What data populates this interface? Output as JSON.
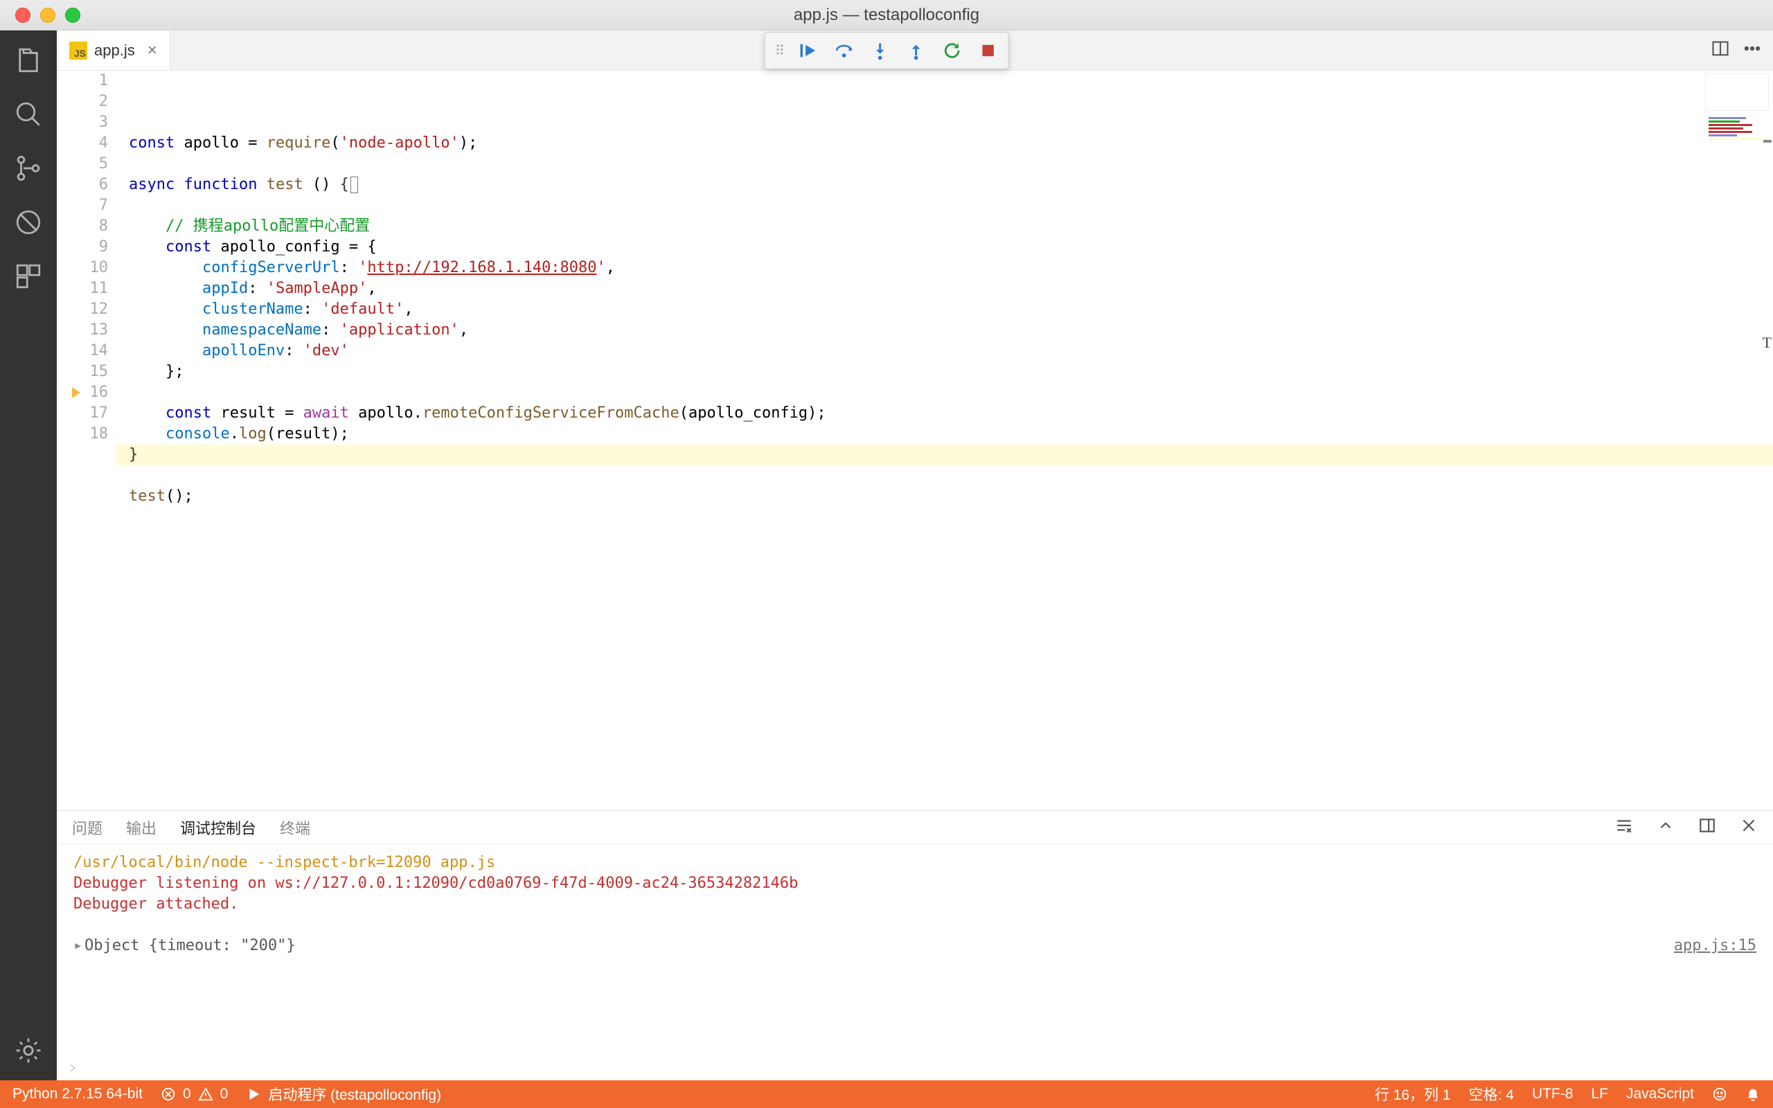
{
  "window": {
    "title": "app.js — testapolloconfig"
  },
  "tab": {
    "filename": "app.js"
  },
  "debug_toolbar": {
    "continue": "Continue",
    "step_over": "Step Over",
    "step_into": "Step Into",
    "step_out": "Step Out",
    "restart": "Restart",
    "stop": "Stop"
  },
  "editor": {
    "highlighted_line": 16,
    "lines": [
      {
        "n": 1,
        "t": "const apollo = require('node-apollo');"
      },
      {
        "n": 2,
        "t": ""
      },
      {
        "n": 3,
        "t": "async function test () {"
      },
      {
        "n": 4,
        "t": ""
      },
      {
        "n": 5,
        "t": "    // 携程apollo配置中心配置"
      },
      {
        "n": 6,
        "t": "    const apollo_config = {"
      },
      {
        "n": 7,
        "t": "        configServerUrl: 'http://192.168.1.140:8080',"
      },
      {
        "n": 8,
        "t": "        appId: 'SampleApp',"
      },
      {
        "n": 9,
        "t": "        clusterName: 'default',"
      },
      {
        "n": 10,
        "t": "        namespaceName: 'application',"
      },
      {
        "n": 11,
        "t": "        apolloEnv: 'dev'"
      },
      {
        "n": 12,
        "t": "    };"
      },
      {
        "n": 13,
        "t": ""
      },
      {
        "n": 14,
        "t": "    const result = await apollo.remoteConfigServiceFromCache(apollo_config);"
      },
      {
        "n": 15,
        "t": "    console.log(result);"
      },
      {
        "n": 16,
        "t": "}"
      },
      {
        "n": 17,
        "t": ""
      },
      {
        "n": 18,
        "t": "test();"
      }
    ]
  },
  "panel": {
    "tabs": {
      "problems": "问题",
      "output": "输出",
      "debug_console": "调试控制台",
      "terminal": "终端"
    },
    "active_tab": "debug_console",
    "lines": [
      {
        "cls": "pc-orange",
        "t": "/usr/local/bin/node --inspect-brk=12090 app.js"
      },
      {
        "cls": "pc-red",
        "t": "Debugger listening on ws://127.0.0.1:12090/cd0a0769-f47d-4009-ac24-36534282146b"
      },
      {
        "cls": "pc-red",
        "t": "Debugger attached."
      }
    ],
    "object_line": "Object {timeout: \"200\"}",
    "object_source": "app.js:15"
  },
  "statusbar": {
    "python": "Python 2.7.15 64-bit",
    "errors": "0",
    "warnings": "0",
    "launch": "启动程序 (testapolloconfig)",
    "cursor": "行 16，列 1",
    "spaces": "空格: 4",
    "encoding": "UTF-8",
    "eol": "LF",
    "language": "JavaScript"
  }
}
